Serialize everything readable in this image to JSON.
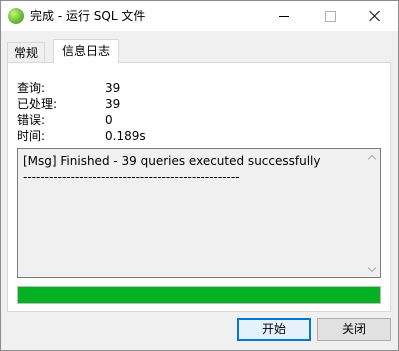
{
  "window": {
    "title": "完成 - 运行 SQL 文件",
    "controls": [
      "minimize-icon",
      "maximize-icon",
      "close-icon"
    ]
  },
  "tabs": [
    {
      "label": "常规",
      "active": false
    },
    {
      "label": "信息日志",
      "active": true
    }
  ],
  "stats": [
    {
      "label": "查询:",
      "value": "39"
    },
    {
      "label": "已处理:",
      "value": "39"
    },
    {
      "label": "错误:",
      "value": "0"
    },
    {
      "label": "时间:",
      "value": "0.189s"
    }
  ],
  "log": {
    "text": "[Msg] Finished - 39 queries executed successfully\n--------------------------------------------------"
  },
  "progress": {
    "percent": 100,
    "color": "#06b025"
  },
  "buttons": {
    "start_label": "开始",
    "close_label": "关闭"
  },
  "colors": {
    "accent": "#0078d7",
    "progress": "#06b025"
  }
}
